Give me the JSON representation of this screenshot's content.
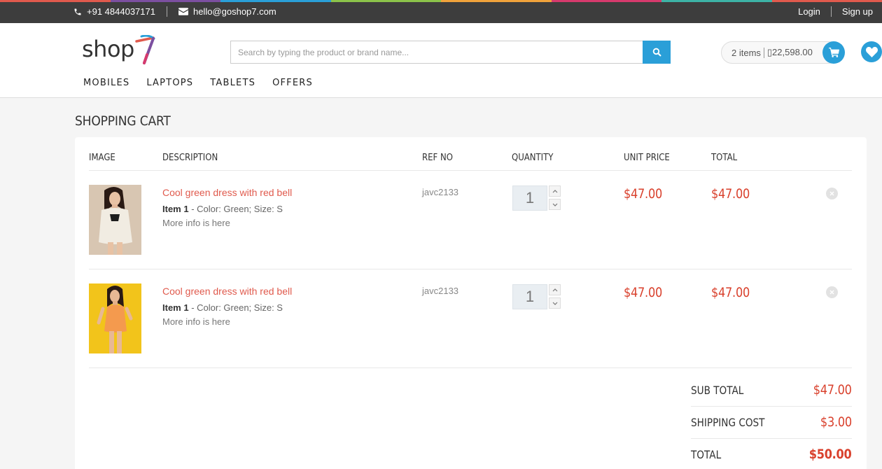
{
  "topbar": {
    "phone": "+91 4844037171",
    "email": "hello@goshop7.com",
    "login": "Login",
    "signup": "Sign up",
    "stripe_colors": [
      "#e05a4d",
      "#7c4fa0",
      "#2a9fd8",
      "#8bc34a",
      "#f0a23b",
      "#d63a6d",
      "#3db3a6",
      "#e05a4d"
    ]
  },
  "header": {
    "logo_text": "shop",
    "logo_mark": "7",
    "search_placeholder": "Search by typing the product or brand name...",
    "cart_items": "2 items",
    "cart_total": "▯22,598.00",
    "nav": [
      "MOBILES",
      "LAPTOPS",
      "TABLETS",
      "OFFERS"
    ],
    "accent": "#2a9fd8"
  },
  "cart": {
    "title": "SHOPPING CART",
    "columns": {
      "image": "IMAGE",
      "description": "DESCRIPTION",
      "ref": "REF NO",
      "quantity": "QUANTITY",
      "unit_price": "UNIT PRICE",
      "total": "TOTAL"
    },
    "items": [
      {
        "name": "Cool green dress with red bell",
        "item_label": "Item 1",
        "details": " - Color: Green; Size: S",
        "more": "More info is here",
        "ref": "javc2133",
        "quantity": "1",
        "unit_price": "$47.00",
        "total": "$47.00",
        "image": "woman-white-shirt-photo"
      },
      {
        "name": "Cool green dress with red bell",
        "item_label": "Item 1",
        "details": " - Color: Green; Size: S",
        "more": "More info is here",
        "ref": "javc2133",
        "quantity": "1",
        "unit_price": "$47.00",
        "total": "$47.00",
        "image": "woman-orange-dress-photo"
      }
    ],
    "summary": {
      "subtotal_label": "SUB TOTAL",
      "subtotal": "$47.00",
      "shipping_label": "SHIPPING COST",
      "shipping": "$3.00",
      "total_label": "TOTAL",
      "total": "$50.00"
    },
    "price_color": "#d9412d",
    "link_color": "#e05a4d"
  }
}
